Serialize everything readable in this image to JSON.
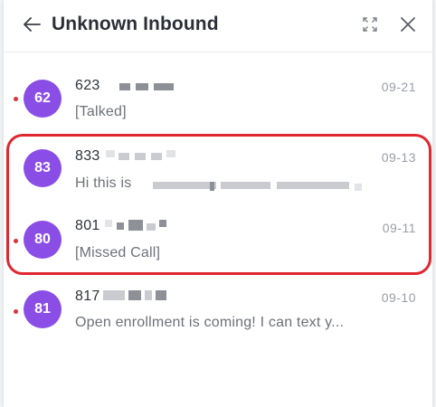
{
  "header": {
    "title": "Unknown Inbound",
    "back_icon": "arrow-left-icon",
    "expand_icon": "expand-icon",
    "close_icon": "close-icon"
  },
  "conversations": [
    {
      "avatar": "62",
      "phone": "623",
      "date": "09-21",
      "preview": "[Talked]",
      "unread": true
    },
    {
      "avatar": "83",
      "phone": "833",
      "date": "09-13",
      "preview": "Hi this is",
      "unread": false
    },
    {
      "avatar": "80",
      "phone": "801",
      "date": "09-11",
      "preview": "[Missed Call]",
      "unread": true
    },
    {
      "avatar": "81",
      "phone": "817",
      "date": "09-10",
      "preview": "Open enrollment is coming! I can text y...",
      "unread": true
    }
  ],
  "colors": {
    "avatar": "#8a4ee6",
    "unread_dot": "#e0323a",
    "highlight_border": "#e0262f"
  }
}
